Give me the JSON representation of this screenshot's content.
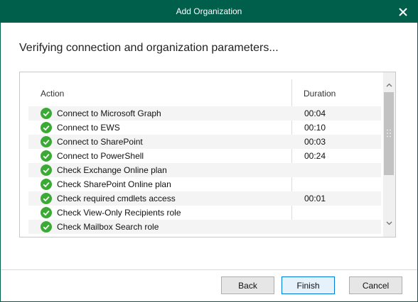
{
  "window": {
    "title": "Add Organization"
  },
  "heading": "Verifying connection and organization parameters...",
  "table": {
    "columns": [
      "Action",
      "Duration"
    ],
    "rows": [
      {
        "action": "Connect to Microsoft Graph",
        "duration": "00:04",
        "status": "success"
      },
      {
        "action": "Connect to EWS",
        "duration": "00:10",
        "status": "success"
      },
      {
        "action": "Connect to SharePoint",
        "duration": "00:03",
        "status": "success"
      },
      {
        "action": "Connect to PowerShell",
        "duration": "00:24",
        "status": "success"
      },
      {
        "action": "Check Exchange Online plan",
        "duration": "",
        "status": "success"
      },
      {
        "action": "Check SharePoint Online plan",
        "duration": "",
        "status": "success"
      },
      {
        "action": "Check required cmdlets access",
        "duration": "00:01",
        "status": "success"
      },
      {
        "action": "Check View-Only Recipients role",
        "duration": "",
        "status": "success"
      },
      {
        "action": "Check Mailbox Search role",
        "duration": "",
        "status": "success"
      }
    ]
  },
  "buttons": {
    "back": "Back",
    "finish": "Finish",
    "cancel": "Cancel"
  },
  "icons": {
    "close": "close-icon",
    "check": "success-check-icon",
    "scroll_up": "chevron-up-icon",
    "scroll_down": "chevron-down-icon"
  },
  "colors": {
    "titlebar": "#005f4b",
    "success": "#3aaa35",
    "finish_border": "#0078d7"
  }
}
